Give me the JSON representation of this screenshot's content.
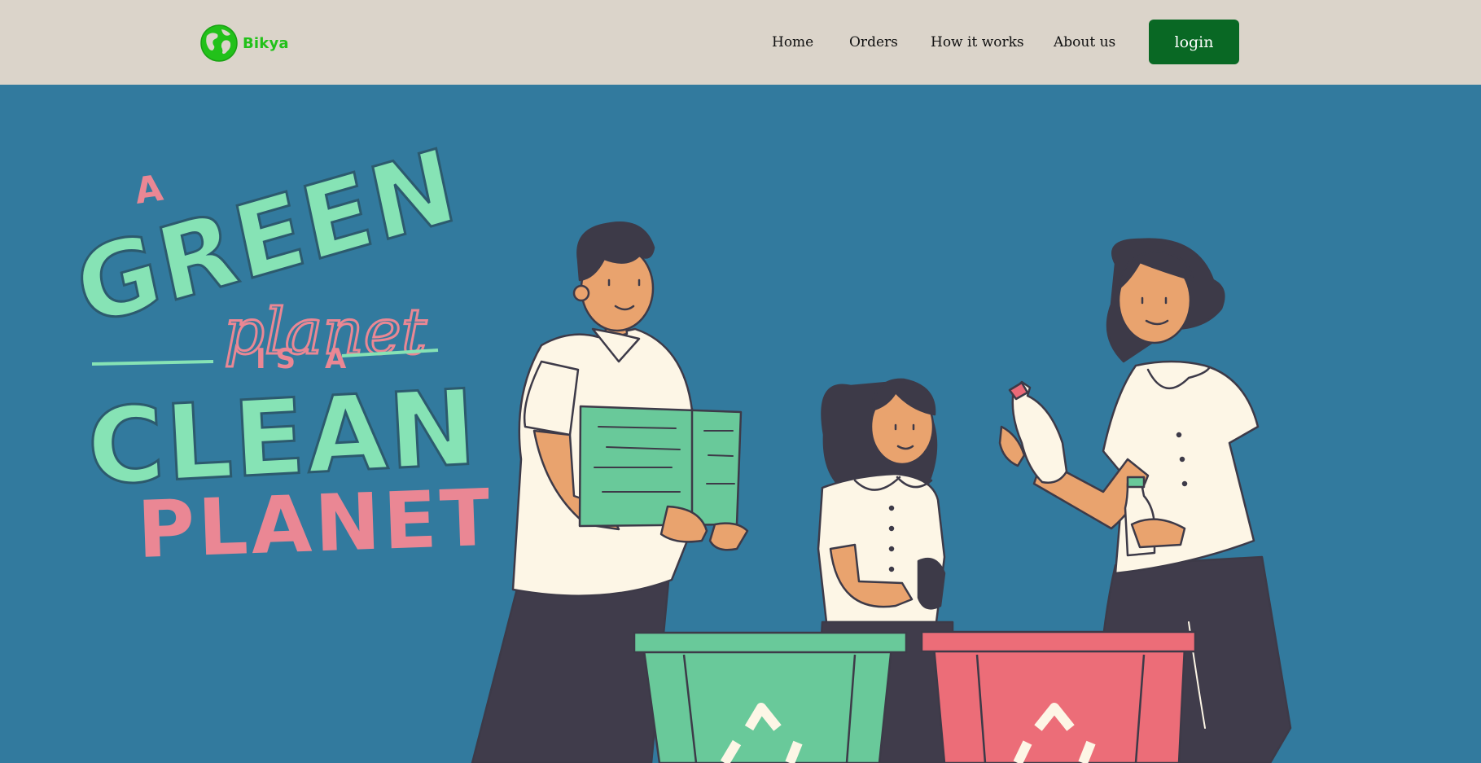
{
  "brand": {
    "name": "Bikya",
    "logo_icon": "globe-icon"
  },
  "nav": {
    "items": [
      {
        "label": "Home"
      },
      {
        "label": "Orders"
      },
      {
        "label": "How it works"
      },
      {
        "label": "About us"
      }
    ],
    "login_label": "login"
  },
  "hero": {
    "slogan_lettering": [
      "A",
      "GREEN",
      "planet",
      "IS A",
      "CLEAN",
      "PLANET"
    ]
  },
  "colors": {
    "navbar_bg": "#dbd4ca",
    "hero_bg": "#327a9e",
    "brand_green": "#22c11a",
    "login_bg": "#096824",
    "lettering_mint": "#86e3b5",
    "lettering_pink": "#ea8794",
    "bin_green": "#69c99a",
    "bin_red": "#ec6d78"
  }
}
